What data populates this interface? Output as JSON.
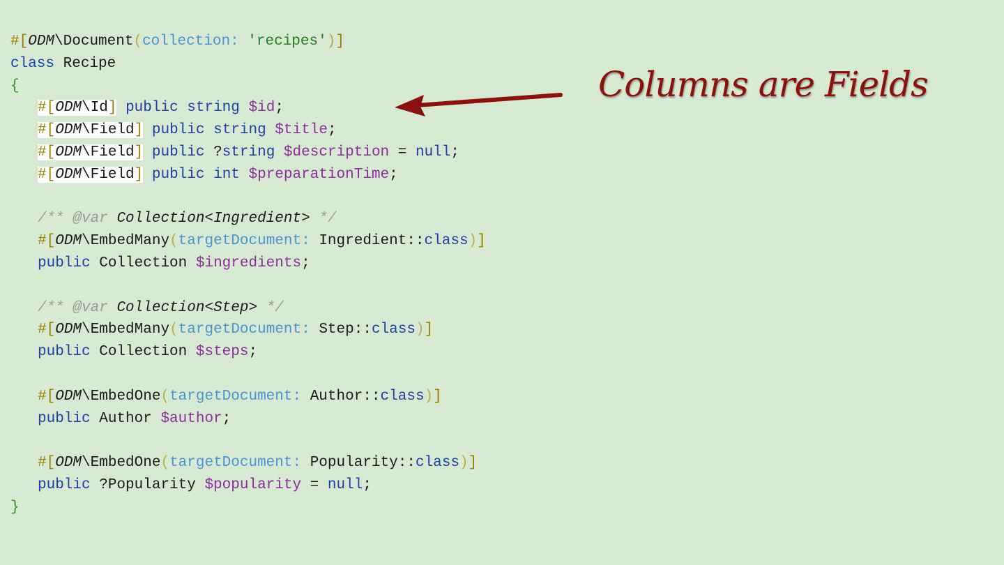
{
  "colors": {
    "background": "#d8e9d3",
    "default": "#1a1a1a",
    "attribute_marker": "#9a8000",
    "keyword": "#1d3fa8",
    "variable": "#8a2f9a",
    "named_arg": "#4f92d4",
    "string": "#277a27",
    "comment": "#9a9a9a",
    "brace": "#3f8f2f",
    "paren": "#b6ae4a",
    "annotation": "#8b1010"
  },
  "code_lines": [
    {
      "indent": 0,
      "tokens": [
        {
          "t": "#[",
          "c": "attribute_marker"
        },
        {
          "t": "ODM",
          "c": "default",
          "i": true
        },
        {
          "t": "\\Document",
          "c": "default"
        },
        {
          "t": "(",
          "c": "paren"
        },
        {
          "t": "collection: ",
          "c": "named_arg"
        },
        {
          "t": "'recipes'",
          "c": "string"
        },
        {
          "t": ")",
          "c": "paren"
        },
        {
          "t": "]",
          "c": "attribute_marker"
        }
      ]
    },
    {
      "indent": 0,
      "tokens": [
        {
          "t": "class",
          "c": "keyword"
        },
        {
          "t": " Recipe",
          "c": "default"
        }
      ]
    },
    {
      "indent": 0,
      "tokens": [
        {
          "t": "{",
          "c": "brace"
        }
      ]
    },
    {
      "indent": 1,
      "tokens": [
        {
          "t": "#[",
          "c": "attribute_marker",
          "h": true
        },
        {
          "t": "ODM",
          "c": "default",
          "i": true,
          "h": true
        },
        {
          "t": "\\Id",
          "c": "default",
          "h": true
        },
        {
          "t": "]",
          "c": "attribute_marker",
          "h": true
        },
        {
          "t": " ",
          "c": "default"
        },
        {
          "t": "public string ",
          "c": "keyword"
        },
        {
          "t": "$id",
          "c": "variable"
        },
        {
          "t": ";",
          "c": "default"
        }
      ]
    },
    {
      "indent": 1,
      "tokens": [
        {
          "t": "#[",
          "c": "attribute_marker",
          "h": true
        },
        {
          "t": "ODM",
          "c": "default",
          "i": true,
          "h": true
        },
        {
          "t": "\\Field",
          "c": "default",
          "h": true
        },
        {
          "t": "]",
          "c": "attribute_marker",
          "h": true
        },
        {
          "t": " ",
          "c": "default"
        },
        {
          "t": "public string ",
          "c": "keyword"
        },
        {
          "t": "$title",
          "c": "variable"
        },
        {
          "t": ";",
          "c": "default"
        }
      ]
    },
    {
      "indent": 1,
      "tokens": [
        {
          "t": "#[",
          "c": "attribute_marker",
          "h": true
        },
        {
          "t": "ODM",
          "c": "default",
          "i": true,
          "h": true
        },
        {
          "t": "\\Field",
          "c": "default",
          "h": true
        },
        {
          "t": "]",
          "c": "attribute_marker",
          "h": true
        },
        {
          "t": " ",
          "c": "default"
        },
        {
          "t": "public ",
          "c": "keyword"
        },
        {
          "t": "?",
          "c": "default"
        },
        {
          "t": "string ",
          "c": "keyword"
        },
        {
          "t": "$description",
          "c": "variable"
        },
        {
          "t": " = ",
          "c": "default"
        },
        {
          "t": "null",
          "c": "keyword"
        },
        {
          "t": ";",
          "c": "default"
        }
      ]
    },
    {
      "indent": 1,
      "tokens": [
        {
          "t": "#[",
          "c": "attribute_marker",
          "h": true
        },
        {
          "t": "ODM",
          "c": "default",
          "i": true,
          "h": true
        },
        {
          "t": "\\Field",
          "c": "default",
          "h": true
        },
        {
          "t": "]",
          "c": "attribute_marker",
          "h": true
        },
        {
          "t": " ",
          "c": "default"
        },
        {
          "t": "public int ",
          "c": "keyword"
        },
        {
          "t": "$preparationTime",
          "c": "variable"
        },
        {
          "t": ";",
          "c": "default"
        }
      ]
    },
    {
      "indent": 0,
      "tokens": []
    },
    {
      "indent": 1,
      "tokens": [
        {
          "t": "/** ",
          "c": "comment",
          "i": true
        },
        {
          "t": "@var",
          "c": "comment",
          "i": true
        },
        {
          "t": " Collection<Ingredient>",
          "c": "default",
          "i": true
        },
        {
          "t": " */",
          "c": "comment",
          "i": true
        }
      ]
    },
    {
      "indent": 1,
      "tokens": [
        {
          "t": "#[",
          "c": "attribute_marker"
        },
        {
          "t": "ODM",
          "c": "default",
          "i": true
        },
        {
          "t": "\\EmbedMany",
          "c": "default"
        },
        {
          "t": "(",
          "c": "paren"
        },
        {
          "t": "targetDocument: ",
          "c": "named_arg"
        },
        {
          "t": "Ingredient::",
          "c": "default"
        },
        {
          "t": "class",
          "c": "keyword"
        },
        {
          "t": ")",
          "c": "paren"
        },
        {
          "t": "]",
          "c": "attribute_marker"
        }
      ]
    },
    {
      "indent": 1,
      "tokens": [
        {
          "t": "public",
          "c": "keyword"
        },
        {
          "t": " Collection ",
          "c": "default"
        },
        {
          "t": "$ingredients",
          "c": "variable"
        },
        {
          "t": ";",
          "c": "default"
        }
      ]
    },
    {
      "indent": 0,
      "tokens": []
    },
    {
      "indent": 1,
      "tokens": [
        {
          "t": "/** ",
          "c": "comment",
          "i": true
        },
        {
          "t": "@var",
          "c": "comment",
          "i": true
        },
        {
          "t": " Collection<Step>",
          "c": "default",
          "i": true
        },
        {
          "t": " */",
          "c": "comment",
          "i": true
        }
      ]
    },
    {
      "indent": 1,
      "tokens": [
        {
          "t": "#[",
          "c": "attribute_marker"
        },
        {
          "t": "ODM",
          "c": "default",
          "i": true
        },
        {
          "t": "\\EmbedMany",
          "c": "default"
        },
        {
          "t": "(",
          "c": "paren"
        },
        {
          "t": "targetDocument: ",
          "c": "named_arg"
        },
        {
          "t": "Step::",
          "c": "default"
        },
        {
          "t": "class",
          "c": "keyword"
        },
        {
          "t": ")",
          "c": "paren"
        },
        {
          "t": "]",
          "c": "attribute_marker"
        }
      ]
    },
    {
      "indent": 1,
      "tokens": [
        {
          "t": "public",
          "c": "keyword"
        },
        {
          "t": " Collection ",
          "c": "default"
        },
        {
          "t": "$steps",
          "c": "variable"
        },
        {
          "t": ";",
          "c": "default"
        }
      ]
    },
    {
      "indent": 0,
      "tokens": []
    },
    {
      "indent": 1,
      "tokens": [
        {
          "t": "#[",
          "c": "attribute_marker"
        },
        {
          "t": "ODM",
          "c": "default",
          "i": true
        },
        {
          "t": "\\EmbedOne",
          "c": "default"
        },
        {
          "t": "(",
          "c": "paren"
        },
        {
          "t": "targetDocument: ",
          "c": "named_arg"
        },
        {
          "t": "Author::",
          "c": "default"
        },
        {
          "t": "class",
          "c": "keyword"
        },
        {
          "t": ")",
          "c": "paren"
        },
        {
          "t": "]",
          "c": "attribute_marker"
        }
      ]
    },
    {
      "indent": 1,
      "tokens": [
        {
          "t": "public",
          "c": "keyword"
        },
        {
          "t": " Author ",
          "c": "default"
        },
        {
          "t": "$author",
          "c": "variable"
        },
        {
          "t": ";",
          "c": "default"
        }
      ]
    },
    {
      "indent": 0,
      "tokens": []
    },
    {
      "indent": 1,
      "tokens": [
        {
          "t": "#[",
          "c": "attribute_marker"
        },
        {
          "t": "ODM",
          "c": "default",
          "i": true
        },
        {
          "t": "\\EmbedOne",
          "c": "default"
        },
        {
          "t": "(",
          "c": "paren"
        },
        {
          "t": "targetDocument: ",
          "c": "named_arg"
        },
        {
          "t": "Popularity::",
          "c": "default"
        },
        {
          "t": "class",
          "c": "keyword"
        },
        {
          "t": ")",
          "c": "paren"
        },
        {
          "t": "]",
          "c": "attribute_marker"
        }
      ]
    },
    {
      "indent": 1,
      "tokens": [
        {
          "t": "public",
          "c": "keyword"
        },
        {
          "t": " ?Popularity ",
          "c": "default"
        },
        {
          "t": "$popularity",
          "c": "variable"
        },
        {
          "t": " = ",
          "c": "default"
        },
        {
          "t": "null",
          "c": "keyword"
        },
        {
          "t": ";",
          "c": "default"
        }
      ]
    },
    {
      "indent": 0,
      "tokens": [
        {
          "t": "}",
          "c": "brace"
        }
      ]
    }
  ],
  "annotation": {
    "text": "Columns are Fields"
  }
}
